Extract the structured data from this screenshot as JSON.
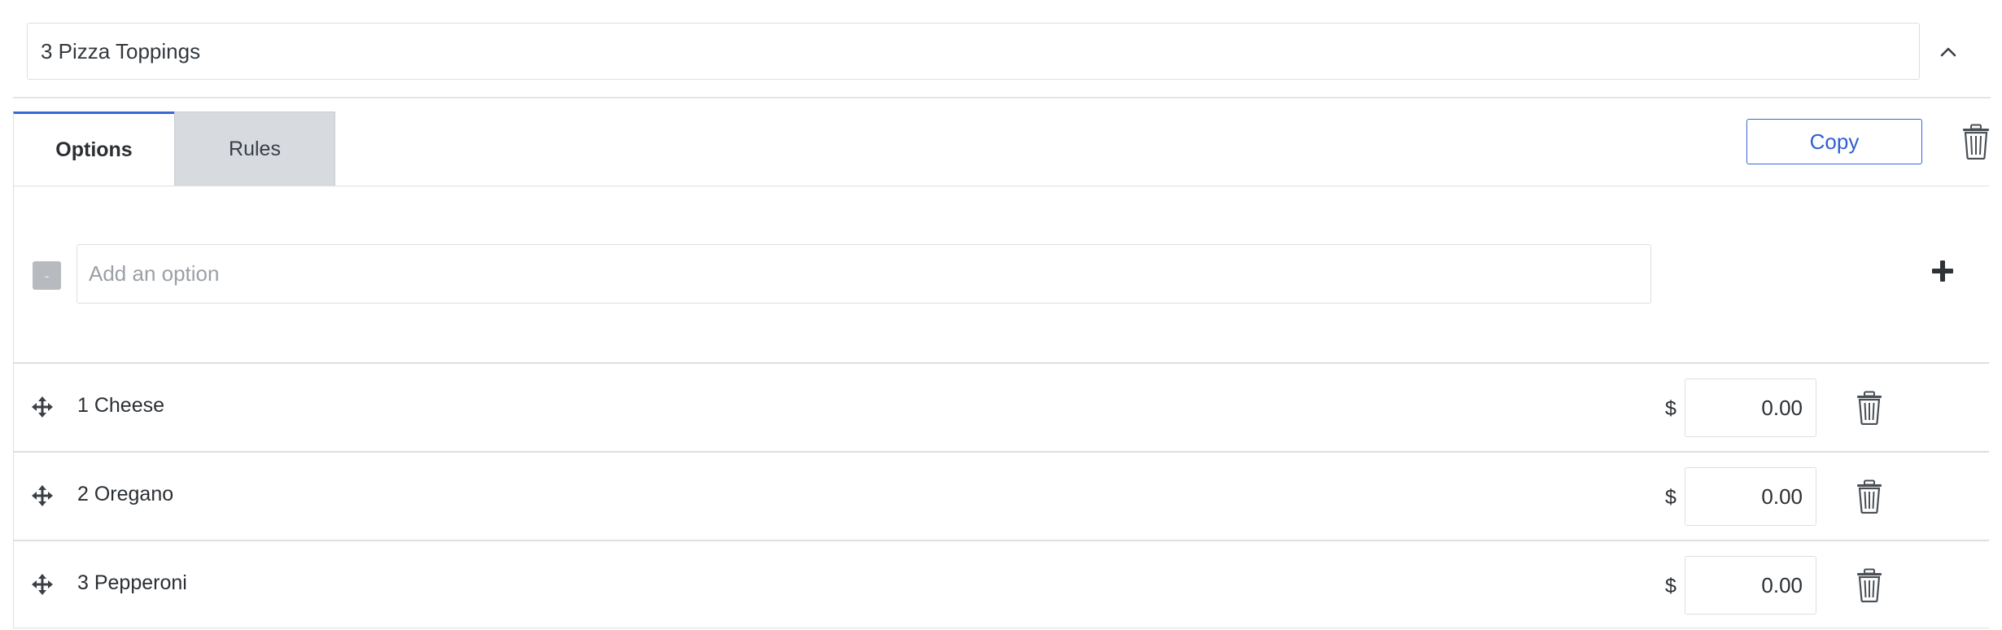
{
  "group": {
    "title": "3 Pizza Toppings",
    "collapse_icon": "chevron-up-icon"
  },
  "tabs": [
    {
      "label": "Options",
      "active": true
    },
    {
      "label": "Rules",
      "active": false
    }
  ],
  "actions": {
    "copy_label": "Copy",
    "delete_icon": "trash-icon"
  },
  "add_option": {
    "placeholder": "Add an option",
    "value": "",
    "add_icon": "plus-icon"
  },
  "options": [
    {
      "name": "1 Cheese",
      "currency": "$",
      "price": "0.00"
    },
    {
      "name": "2 Oregano",
      "currency": "$",
      "price": "0.00"
    },
    {
      "name": "3 Pepperoni",
      "currency": "$",
      "price": "0.00"
    }
  ],
  "colors": {
    "accent": "#3a66d6",
    "border": "#dcdfe3",
    "inactive_tab": "#d7dade",
    "icon": "#4a4f55"
  }
}
